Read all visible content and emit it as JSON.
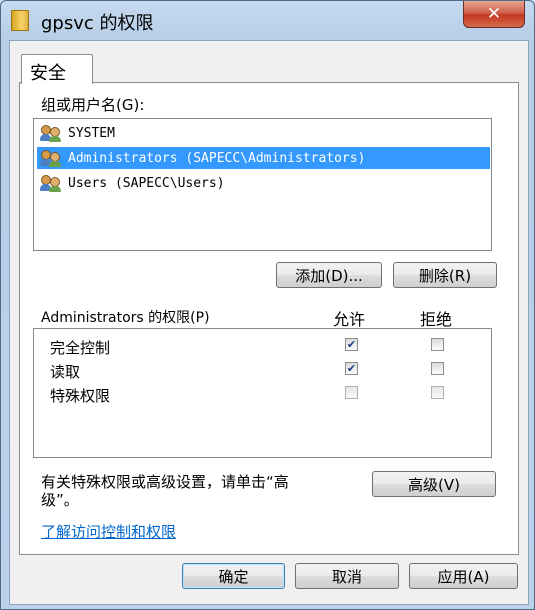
{
  "window": {
    "title": "gpsvc 的权限",
    "close_glyph": "✕"
  },
  "tabs": [
    {
      "label": "安全"
    }
  ],
  "groups": {
    "label": "组或用户名(G):",
    "items": [
      {
        "name": "SYSTEM",
        "icon": "users-group-icon",
        "selected": false
      },
      {
        "name": "Administrators (SAPECC\\Administrators)",
        "icon": "users-group-icon",
        "selected": true
      },
      {
        "name": "Users (SAPECC\\Users)",
        "icon": "users-group-icon",
        "selected": false
      }
    ],
    "add_button": "添加(D)...",
    "remove_button": "删除(R)"
  },
  "permissions": {
    "label": "Administrators 的权限(P)",
    "allow_header": "允许",
    "deny_header": "拒绝",
    "rows": [
      {
        "name": "完全控制",
        "allow": true,
        "deny": false
      },
      {
        "name": "读取",
        "allow": true,
        "deny": false
      },
      {
        "name": "特殊权限",
        "allow": false,
        "deny": false
      }
    ]
  },
  "advanced": {
    "text_line1": "有关特殊权限或高级设置，请单击“高",
    "text_line2": "级”。",
    "button": "高级(V)"
  },
  "link": {
    "text": "了解访问控制和权限"
  },
  "footer": {
    "ok": "确定",
    "cancel": "取消",
    "apply": "应用(A)"
  },
  "colors": {
    "selection": "#3399ff",
    "link": "#0066cc",
    "close_button": "#c2381f"
  }
}
